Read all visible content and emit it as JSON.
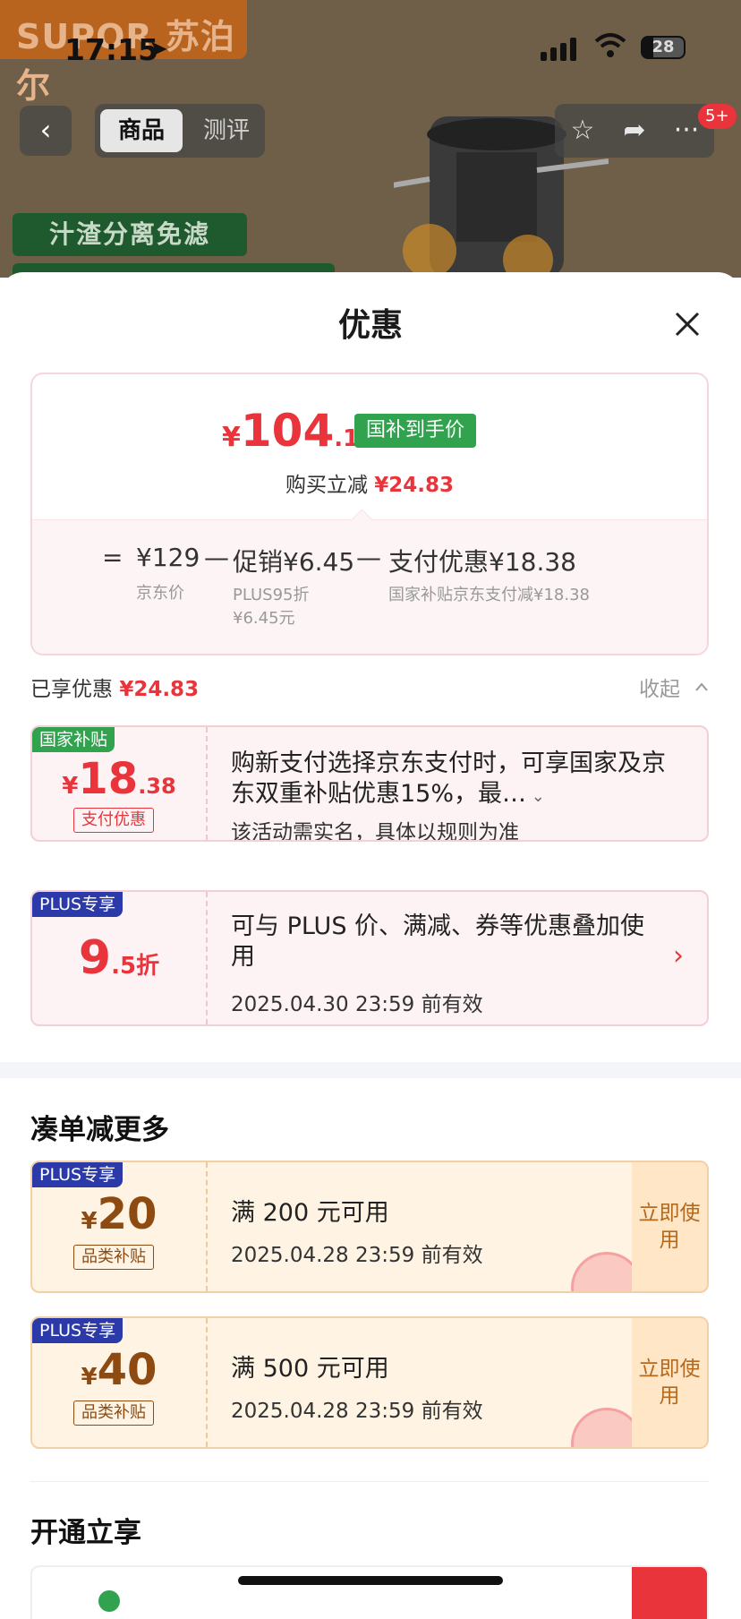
{
  "status_bar": {
    "time": "17:15",
    "battery": "28"
  },
  "header": {
    "brand_text": "SUPOR 苏泊尔",
    "tabs": [
      "商品",
      "测评"
    ],
    "active_tab": "商品",
    "message_badge": "5+",
    "promo_banner": "汁渣分离免滤"
  },
  "sheet": {
    "title": "优惠",
    "price_summary": {
      "final_price_symbol": "¥",
      "final_price_int": "104",
      "final_price_dec": ".17",
      "final_price_badge": "国补到手价",
      "reduce_label": "购买立减",
      "reduce_amount": "¥24.83",
      "equals": "=",
      "base_price": "¥129",
      "base_price_label": "京东价",
      "minus": "—",
      "promo": "促销¥6.45",
      "promo_label_1": "PLUS95折",
      "promo_label_2": "¥6.45元",
      "payment": "支付优惠¥18.38",
      "payment_label": "国家补贴京东支付减¥18.38"
    },
    "enjoyed_label": "已享优惠",
    "enjoyed_amount": "¥24.83",
    "collapse_label": "收起",
    "coupons": [
      {
        "tag": "国家补贴",
        "tag_color": "#31a24d",
        "symbol": "¥",
        "amount_int": "18",
        "amount_dec": ".38",
        "category": "支付优惠",
        "description": "购新支付选择京东支付时，可享国家及京东双重补贴优惠15%，最…",
        "note": "该活动需实名，具体以规则为准"
      },
      {
        "tag": "PLUS专享",
        "tag_color": "#2b3aa8",
        "amount_int": "9",
        "amount_dec": ".5折",
        "description": "可与 PLUS 价、满减、券等优惠叠加使用",
        "note": "2025.04.30 23:59 前有效"
      }
    ],
    "more_section_title": "凑单减更多",
    "more_coupons": [
      {
        "tag": "PLUS专享",
        "symbol": "¥",
        "amount": "20",
        "category": "品类补贴",
        "condition": "满 200 元可用",
        "validity": "2025.04.28 23:59 前有效",
        "action": "立即使用"
      },
      {
        "tag": "PLUS专享",
        "symbol": "¥",
        "amount": "40",
        "category": "品类补贴",
        "condition": "满 500 元可用",
        "validity": "2025.04.28 23:59 前有效",
        "action": "立即使用"
      }
    ],
    "open_section_title": "开通立享"
  },
  "colors": {
    "accent_red": "#e8343a",
    "green": "#31a24d",
    "plus_blue": "#2b3aa8",
    "orange_text": "#8d4b12"
  }
}
